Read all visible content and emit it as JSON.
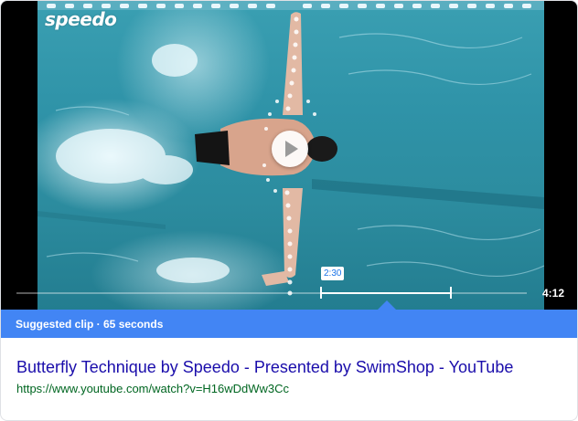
{
  "video": {
    "logo_text": "speedo",
    "play_icon": "play-icon",
    "clip_start_label": "2:30",
    "duration": "4:12"
  },
  "suggested_clip": {
    "text": "Suggested clip · 65 seconds"
  },
  "result": {
    "title": "Butterfly Technique by Speedo - Presented by SwimShop - YouTube",
    "url": "https://www.youtube.com/watch?v=H16wDdWw3Cc"
  },
  "colors": {
    "banner": "#4285f4",
    "title_link": "#1a0dab",
    "url": "#006621",
    "water": "#2f93a8"
  }
}
